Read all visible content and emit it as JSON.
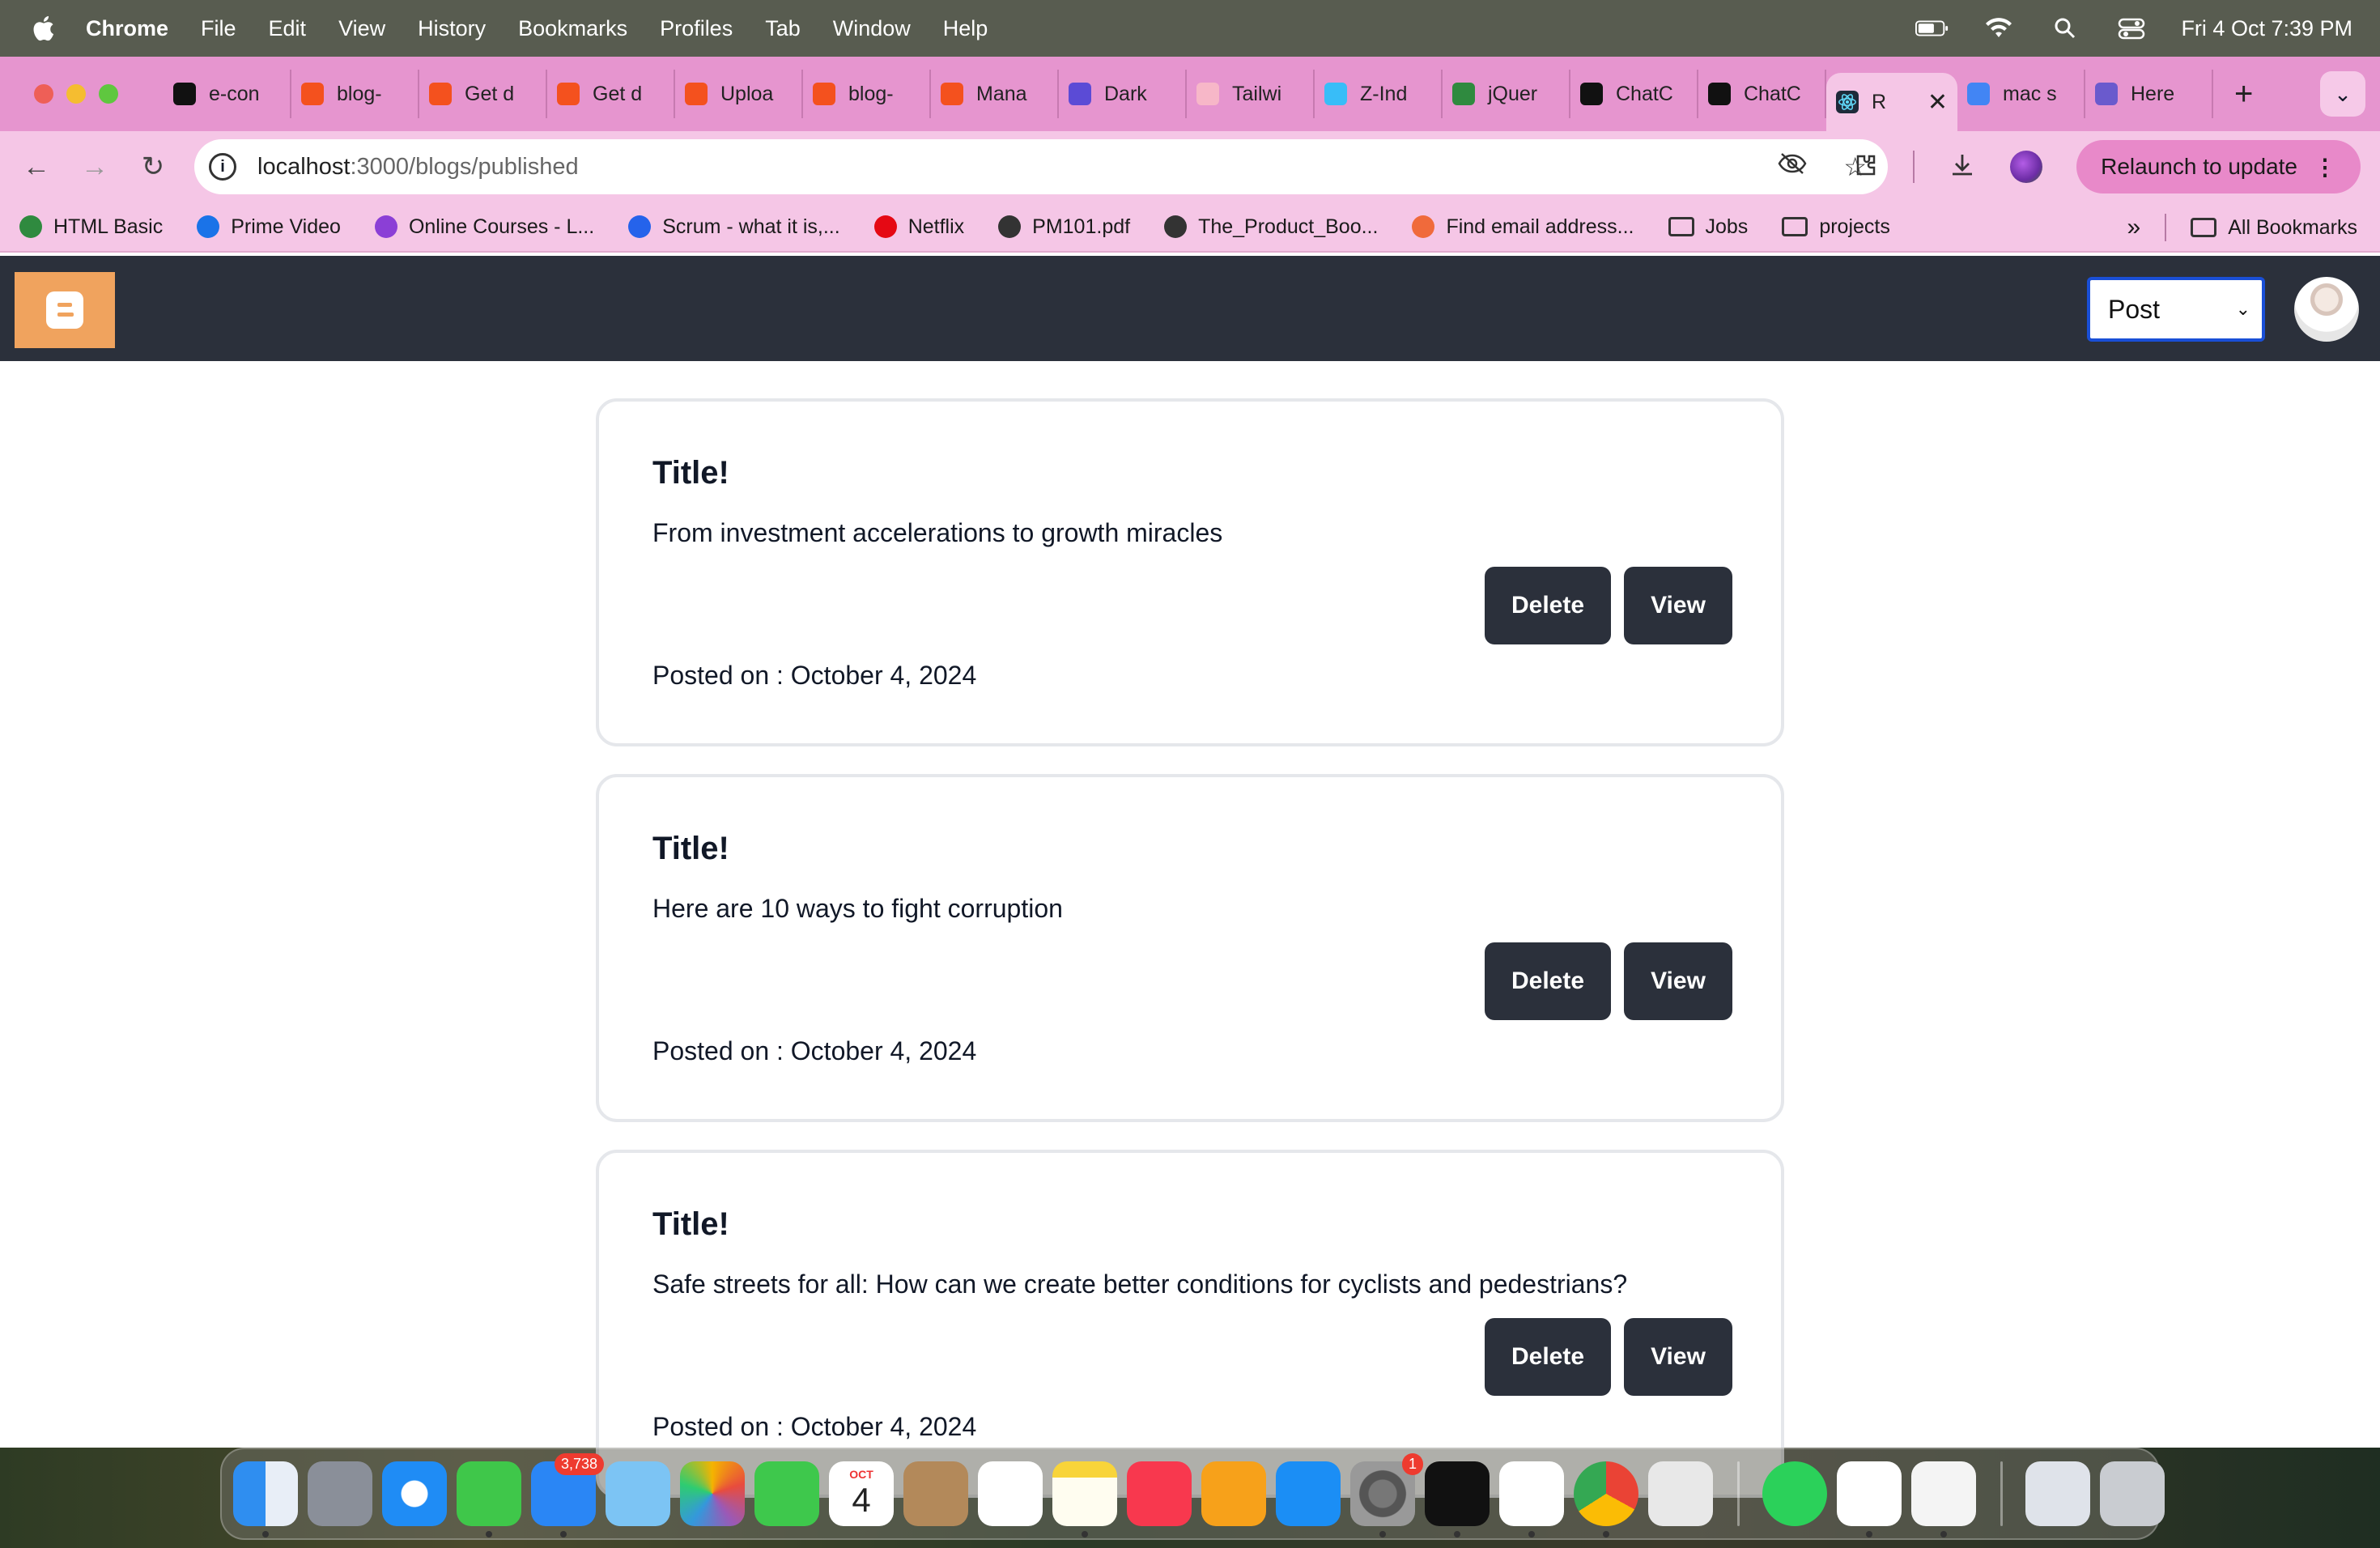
{
  "menubar": {
    "app": "Chrome",
    "items": [
      "File",
      "Edit",
      "View",
      "History",
      "Bookmarks",
      "Profiles",
      "Tab",
      "Window",
      "Help"
    ],
    "clock": "Fri 4 Oct  7:39 PM"
  },
  "tabs": [
    {
      "label": "e-con",
      "color": "#111111"
    },
    {
      "label": "blog-",
      "color": "#f4511e"
    },
    {
      "label": "Get d",
      "color": "#f4511e"
    },
    {
      "label": "Get d",
      "color": "#f4511e"
    },
    {
      "label": "Uploa",
      "color": "#f4511e"
    },
    {
      "label": "blog-",
      "color": "#f4511e"
    },
    {
      "label": "Mana",
      "color": "#f4511e"
    },
    {
      "label": "Dark",
      "color": "#5b4bd6"
    },
    {
      "label": "Tailwi",
      "color": "#f7b7c8"
    },
    {
      "label": "Z-Ind",
      "color": "#38bdf8"
    },
    {
      "label": "jQuer",
      "color": "#2f8a3f"
    },
    {
      "label": "ChatC",
      "color": "#111111"
    },
    {
      "label": "ChatC",
      "color": "#111111"
    }
  ],
  "active_tab": {
    "label": "R",
    "color": "#1e2a3a"
  },
  "tabs_after": [
    {
      "label": "mac s",
      "color": "#4285f4"
    },
    {
      "label": "Here",
      "color": "#6a5acd"
    }
  ],
  "address": {
    "host": "localhost",
    "path": ":3000/blogs/published"
  },
  "relaunch_label": "Relaunch to update",
  "bookmarks": [
    {
      "label": "HTML Basic",
      "icon": "w3-icon",
      "color": "#2f8a3f"
    },
    {
      "label": "Prime Video",
      "icon": "prime-icon",
      "color": "#1a73e8"
    },
    {
      "label": "Online Courses - L...",
      "icon": "udemy-icon",
      "color": "#8b3fd6"
    },
    {
      "label": "Scrum - what it is,...",
      "icon": "atlassian-icon",
      "color": "#2563eb"
    },
    {
      "label": "Netflix",
      "icon": "netflix-icon",
      "color": "#e50914"
    },
    {
      "label": "PM101.pdf",
      "icon": "globe-icon",
      "color": "#333333"
    },
    {
      "label": "The_Product_Boo...",
      "icon": "globe-icon",
      "color": "#333333"
    },
    {
      "label": "Find email address...",
      "icon": "hunter-icon",
      "color": "#f06a3b"
    }
  ],
  "bookmark_folders": [
    "Jobs",
    "projects"
  ],
  "all_bookmarks": "All Bookmarks",
  "appnav": {
    "select_value": "Post"
  },
  "posts": [
    {
      "title": "Title!",
      "desc": "From investment accelerations to growth miracles",
      "delete": "Delete",
      "view": "View",
      "date": "Posted on : October 4, 2024"
    },
    {
      "title": "Title!",
      "desc": "Here are 10 ways to fight corruption",
      "delete": "Delete",
      "view": "View",
      "date": "Posted on : October 4, 2024"
    },
    {
      "title": "Title!",
      "desc": "Safe streets for all: How can we create better conditions for cyclists and pedestrians?",
      "delete": "Delete",
      "view": "View",
      "date": "Posted on : October 4, 2024"
    }
  ],
  "dock": {
    "mail_badge": "3,738",
    "settings_badge": "1",
    "calendar_month": "OCT",
    "calendar_day": "4"
  }
}
